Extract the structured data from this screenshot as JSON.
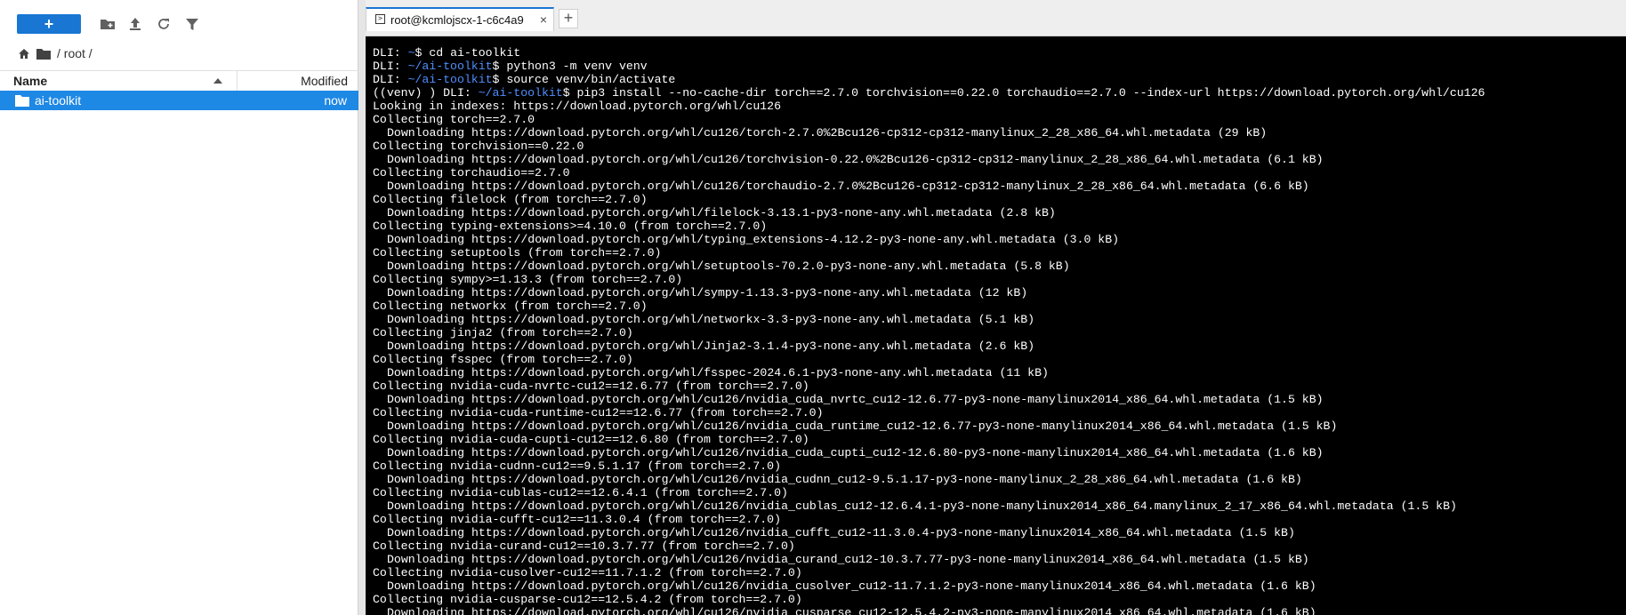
{
  "file_browser": {
    "new_button_label": "+",
    "toolbar_icons": [
      "new-folder-icon",
      "upload-icon",
      "refresh-icon",
      "filter-icon"
    ],
    "breadcrumb": "/ root /",
    "columns": {
      "name": "Name",
      "modified": "Modified"
    },
    "files": [
      {
        "name": "ai-toolkit",
        "modified": "now",
        "type": "folder",
        "selected": true
      }
    ]
  },
  "terminal": {
    "tab_title": "root@kcmlojscx-1-c6c4a9",
    "tab_close": "×",
    "add_tab": "+",
    "prompt_host": "DLI: ",
    "lines": [
      {
        "host": "DLI: ",
        "path": "~",
        "cmd": "$ cd ai-toolkit"
      },
      {
        "host": "DLI: ",
        "path": "~/ai-toolkit",
        "cmd": "$ python3 -m venv venv"
      },
      {
        "host": "DLI: ",
        "path": "~/ai-toolkit",
        "cmd": "$ source venv/bin/activate"
      },
      {
        "host": "((venv) ) DLI: ",
        "path": "~/ai-toolkit",
        "cmd": "$ pip3 install --no-cache-dir torch==2.7.0 torchvision==0.22.0 torchaudio==2.7.0 --index-url https://download.pytorch.org/whl/cu126"
      },
      {
        "text": "Looking in indexes: https://download.pytorch.org/whl/cu126"
      },
      {
        "text": "Collecting torch==2.7.0"
      },
      {
        "text": "Downloading https://download.pytorch.org/whl/cu126/torch-2.7.0%2Bcu126-cp312-cp312-manylinux_2_28_x86_64.whl.metadata (29 kB)",
        "indent": true
      },
      {
        "text": "Collecting torchvision==0.22.0"
      },
      {
        "text": "Downloading https://download.pytorch.org/whl/cu126/torchvision-0.22.0%2Bcu126-cp312-cp312-manylinux_2_28_x86_64.whl.metadata (6.1 kB)",
        "indent": true
      },
      {
        "text": "Collecting torchaudio==2.7.0"
      },
      {
        "text": "Downloading https://download.pytorch.org/whl/cu126/torchaudio-2.7.0%2Bcu126-cp312-cp312-manylinux_2_28_x86_64.whl.metadata (6.6 kB)",
        "indent": true
      },
      {
        "text": "Collecting filelock (from torch==2.7.0)"
      },
      {
        "text": "Downloading https://download.pytorch.org/whl/filelock-3.13.1-py3-none-any.whl.metadata (2.8 kB)",
        "indent": true
      },
      {
        "text": "Collecting typing-extensions>=4.10.0 (from torch==2.7.0)"
      },
      {
        "text": "Downloading https://download.pytorch.org/whl/typing_extensions-4.12.2-py3-none-any.whl.metadata (3.0 kB)",
        "indent": true
      },
      {
        "text": "Collecting setuptools (from torch==2.7.0)"
      },
      {
        "text": "Downloading https://download.pytorch.org/whl/setuptools-70.2.0-py3-none-any.whl.metadata (5.8 kB)",
        "indent": true
      },
      {
        "text": "Collecting sympy>=1.13.3 (from torch==2.7.0)"
      },
      {
        "text": "Downloading https://download.pytorch.org/whl/sympy-1.13.3-py3-none-any.whl.metadata (12 kB)",
        "indent": true
      },
      {
        "text": "Collecting networkx (from torch==2.7.0)"
      },
      {
        "text": "Downloading https://download.pytorch.org/whl/networkx-3.3-py3-none-any.whl.metadata (5.1 kB)",
        "indent": true
      },
      {
        "text": "Collecting jinja2 (from torch==2.7.0)"
      },
      {
        "text": "Downloading https://download.pytorch.org/whl/Jinja2-3.1.4-py3-none-any.whl.metadata (2.6 kB)",
        "indent": true
      },
      {
        "text": "Collecting fsspec (from torch==2.7.0)"
      },
      {
        "text": "Downloading https://download.pytorch.org/whl/fsspec-2024.6.1-py3-none-any.whl.metadata (11 kB)",
        "indent": true
      },
      {
        "text": "Collecting nvidia-cuda-nvrtc-cu12==12.6.77 (from torch==2.7.0)"
      },
      {
        "text": "Downloading https://download.pytorch.org/whl/cu126/nvidia_cuda_nvrtc_cu12-12.6.77-py3-none-manylinux2014_x86_64.whl.metadata (1.5 kB)",
        "indent": true
      },
      {
        "text": "Collecting nvidia-cuda-runtime-cu12==12.6.77 (from torch==2.7.0)"
      },
      {
        "text": "Downloading https://download.pytorch.org/whl/cu126/nvidia_cuda_runtime_cu12-12.6.77-py3-none-manylinux2014_x86_64.whl.metadata (1.5 kB)",
        "indent": true
      },
      {
        "text": "Collecting nvidia-cuda-cupti-cu12==12.6.80 (from torch==2.7.0)"
      },
      {
        "text": "Downloading https://download.pytorch.org/whl/cu126/nvidia_cuda_cupti_cu12-12.6.80-py3-none-manylinux2014_x86_64.whl.metadata (1.6 kB)",
        "indent": true
      },
      {
        "text": "Collecting nvidia-cudnn-cu12==9.5.1.17 (from torch==2.7.0)"
      },
      {
        "text": "Downloading https://download.pytorch.org/whl/cu126/nvidia_cudnn_cu12-9.5.1.17-py3-none-manylinux_2_28_x86_64.whl.metadata (1.6 kB)",
        "indent": true
      },
      {
        "text": "Collecting nvidia-cublas-cu12==12.6.4.1 (from torch==2.7.0)"
      },
      {
        "text": "Downloading https://download.pytorch.org/whl/cu126/nvidia_cublas_cu12-12.6.4.1-py3-none-manylinux2014_x86_64.manylinux_2_17_x86_64.whl.metadata (1.5 kB)",
        "indent": true
      },
      {
        "text": "Collecting nvidia-cufft-cu12==11.3.0.4 (from torch==2.7.0)"
      },
      {
        "text": "Downloading https://download.pytorch.org/whl/cu126/nvidia_cufft_cu12-11.3.0.4-py3-none-manylinux2014_x86_64.whl.metadata (1.5 kB)",
        "indent": true
      },
      {
        "text": "Collecting nvidia-curand-cu12==10.3.7.77 (from torch==2.7.0)"
      },
      {
        "text": "Downloading https://download.pytorch.org/whl/cu126/nvidia_curand_cu12-10.3.7.77-py3-none-manylinux2014_x86_64.whl.metadata (1.5 kB)",
        "indent": true
      },
      {
        "text": "Collecting nvidia-cusolver-cu12==11.7.1.2 (from torch==2.7.0)"
      },
      {
        "text": "Downloading https://download.pytorch.org/whl/cu126/nvidia_cusolver_cu12-11.7.1.2-py3-none-manylinux2014_x86_64.whl.metadata (1.6 kB)",
        "indent": true
      },
      {
        "text": "Collecting nvidia-cusparse-cu12==12.5.4.2 (from torch==2.7.0)"
      },
      {
        "text": "Downloading https://download.pytorch.org/whl/cu126/nvidia_cusparse_cu12-12.5.4.2-py3-none-manylinux2014_x86_64.whl.metadata (1.6 kB)",
        "indent": true
      }
    ]
  },
  "colors": {
    "accent": "#1976d2",
    "selection": "#1e88e5",
    "terminal_bg": "#000000",
    "terminal_fg": "#ffffff",
    "prompt_path": "#4f8fff"
  }
}
